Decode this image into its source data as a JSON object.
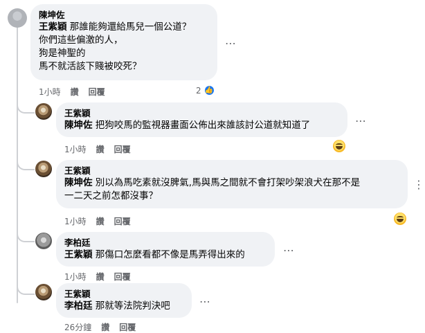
{
  "actions_common": {
    "like": "讚",
    "reply": "回覆"
  },
  "comments": [
    {
      "author": "陳坤佐",
      "mention": "王紫穎",
      "text": "那誰能夠還給馬兒一個公道？\n你們這些偏激的人，\n狗是神聖的\n馬不就活該下賤被咬死？",
      "time": "1小時",
      "like_count": "2"
    },
    {
      "author": "王紫穎",
      "mention": "陳坤佐",
      "text": "把狗咬馬的監視器畫面公佈出來誰該討公道就知道了",
      "time": "1小時"
    },
    {
      "author": "王紫穎",
      "mention": "陳坤佐",
      "text": "別以為馬吃素就沒脾氣,馬與馬之間就不會打架吵架浪犬在那不是\n一二天之前怎都沒事？",
      "time": "1小時"
    },
    {
      "author": "李柏廷",
      "mention": "王紫穎",
      "text": "那傷口怎麼看都不像是馬弄得出來的",
      "time": "1小時"
    },
    {
      "author": "王紫穎",
      "mention": "李柏廷",
      "text": "那就等法院判決吧",
      "time": "26分鐘"
    }
  ],
  "icons": {
    "more": "more-options-icon",
    "like_reaction": "like-reaction-icon",
    "haha_reaction": "haha-reaction-icon"
  },
  "colors": {
    "bubble": "#f0f2f5",
    "like_blue": "#1877f2",
    "meta": "#65676b"
  }
}
